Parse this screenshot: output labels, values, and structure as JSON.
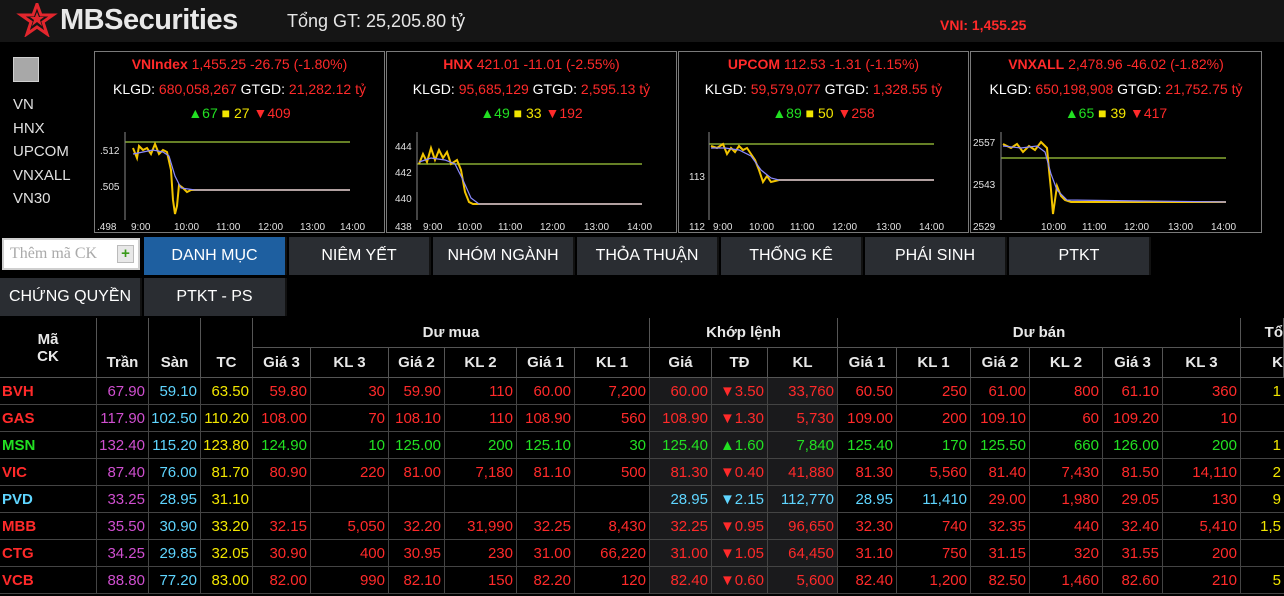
{
  "header": {
    "logo_text": "MBSecurities",
    "total_value": "Tổng GT: 25,205.80 tỷ",
    "ticker_text": "VNI: 1,455.25"
  },
  "colors": {
    "up": "#22e022",
    "down": "#ff2a2a",
    "ref": "#f2e600",
    "ceiling": "#d04fd0",
    "floor": "#5fd5ff",
    "active_tab": "#1e5fa0"
  },
  "index_list": [
    "VN",
    "HNX",
    "UPCOM",
    "VNXALL",
    "VN30"
  ],
  "panels": [
    {
      "name": "VNIndex",
      "value": "1,455.25 -26.75 (-1.80%)",
      "klgd_label": "KLGD:",
      "klgd": "680,058,267",
      "gtgd_label": "GTGD:",
      "gtgd": "21,282.12 tỷ",
      "up": "67",
      "flat": "27",
      "down": "409",
      "y_ticks": [
        ".512",
        ".505",
        ".498"
      ],
      "x_ticks": [
        "9:00",
        "10:00",
        "11:00",
        "12:00",
        "13:00",
        "14:00"
      ]
    },
    {
      "name": "HNX",
      "value": "421.01 -11.01 (-2.55%)",
      "klgd_label": "KLGD:",
      "klgd": "95,685,129",
      "gtgd_label": "GTGD:",
      "gtgd": "2,595.13 tỷ",
      "up": "49",
      "flat": "33",
      "down": "192",
      "y_ticks": [
        "444",
        "442",
        "440",
        "438"
      ],
      "x_ticks": [
        "9:00",
        "10:00",
        "11:00",
        "12:00",
        "13:00",
        "14:00"
      ]
    },
    {
      "name": "UPCOM",
      "value": "112.53 -1.31 (-1.15%)",
      "klgd_label": "KLGD:",
      "klgd": "59,579,077",
      "gtgd_label": "GTGD:",
      "gtgd": "1,328.55 tỷ",
      "up": "89",
      "flat": "50",
      "down": "258",
      "y_ticks": [
        "113",
        "112"
      ],
      "x_ticks": [
        "9:00",
        "10:00",
        "11:00",
        "12:00",
        "13:00",
        "14:00"
      ]
    },
    {
      "name": "VNXALL",
      "value": "2,478.96 -46.02 (-1.82%)",
      "klgd_label": "KLGD:",
      "klgd": "650,198,908",
      "gtgd_label": "GTGD:",
      "gtgd": "21,752.75 tỷ",
      "up": "65",
      "flat": "39",
      "down": "417",
      "y_ticks": [
        "2557",
        "2543",
        "2529"
      ],
      "x_ticks": [
        "10:00",
        "11:00",
        "12:00",
        "13:00",
        "14:00"
      ]
    }
  ],
  "search": {
    "placeholder": "Thêm mã CK",
    "add_icon": "+"
  },
  "tabs_row1": [
    "DANH MỤC",
    "NIÊM YẾT",
    "NHÓM NGÀNH",
    "THỎA THUẬN",
    "THỐNG KÊ",
    "PHÁI SINH",
    "PTKT"
  ],
  "tabs_row2": [
    "CHỨNG QUYỀN",
    "PTKT - PS"
  ],
  "active_tab": "DANH MỤC",
  "table": {
    "group_headers": {
      "code": "Mã CK",
      "buy": "Dư mua",
      "match": "Khớp lệnh",
      "sell": "Dư bán",
      "total_partial": "Tổ"
    },
    "code_line1": "Mã",
    "code_line2": "CK",
    "columns": [
      "Trần",
      "Sàn",
      "TC",
      "Giá 3",
      "KL 3",
      "Giá 2",
      "KL 2",
      "Giá 1",
      "KL 1",
      "Giá",
      "TĐ",
      "KL",
      "Giá 1",
      "KL 1",
      "Giá 2",
      "KL 2",
      "Giá 3",
      "KL 3"
    ],
    "last_col_partial": "K",
    "rows": [
      {
        "code": "BVH",
        "c": "down",
        "tran": "67.90",
        "san": "59.10",
        "tc": "63.50",
        "b3": [
          "59.80",
          "30",
          "down"
        ],
        "b2": [
          "59.90",
          "110",
          "down"
        ],
        "b1": [
          "60.00",
          "7,200",
          "down"
        ],
        "m": [
          "60.00",
          "▼3.50",
          "33,760",
          "down"
        ],
        "s1": [
          "60.50",
          "250",
          "down"
        ],
        "s2": [
          "61.00",
          "800",
          "down"
        ],
        "s3": [
          "61.10",
          "360",
          "down"
        ],
        "tot": "1"
      },
      {
        "code": "GAS",
        "c": "down",
        "tran": "117.90",
        "san": "102.50",
        "tc": "110.20",
        "b3": [
          "108.00",
          "70",
          "down"
        ],
        "b2": [
          "108.10",
          "110",
          "down"
        ],
        "b1": [
          "108.90",
          "560",
          "down"
        ],
        "m": [
          "108.90",
          "▼1.30",
          "5,730",
          "down"
        ],
        "s1": [
          "109.00",
          "200",
          "down"
        ],
        "s2": [
          "109.10",
          "60",
          "down"
        ],
        "s3": [
          "109.20",
          "10",
          "down"
        ],
        "tot": ""
      },
      {
        "code": "MSN",
        "c": "up",
        "tran": "132.40",
        "san": "115.20",
        "tc": "123.80",
        "b3": [
          "124.90",
          "10",
          "up"
        ],
        "b2": [
          "125.00",
          "200",
          "up"
        ],
        "b1": [
          "125.10",
          "30",
          "up"
        ],
        "m": [
          "125.40",
          "▲1.60",
          "7,840",
          "up"
        ],
        "s1": [
          "125.40",
          "170",
          "up"
        ],
        "s2": [
          "125.50",
          "660",
          "up"
        ],
        "s3": [
          "126.00",
          "200",
          "up"
        ],
        "tot": "1"
      },
      {
        "code": "VIC",
        "c": "down",
        "tran": "87.40",
        "san": "76.00",
        "tc": "81.70",
        "b3": [
          "80.90",
          "220",
          "down"
        ],
        "b2": [
          "81.00",
          "7,180",
          "down"
        ],
        "b1": [
          "81.10",
          "500",
          "down"
        ],
        "m": [
          "81.30",
          "▼0.40",
          "41,880",
          "down"
        ],
        "s1": [
          "81.30",
          "5,560",
          "down"
        ],
        "s2": [
          "81.40",
          "7,430",
          "down"
        ],
        "s3": [
          "81.50",
          "14,110",
          "down"
        ],
        "tot": "2"
      },
      {
        "code": "PVD",
        "c": "floor",
        "tran": "33.25",
        "san": "28.95",
        "tc": "31.10",
        "b3": [
          "",
          "",
          "down"
        ],
        "b2": [
          "",
          "",
          "down"
        ],
        "b1": [
          "",
          "",
          "down"
        ],
        "m": [
          "28.95",
          "▼2.15",
          "112,770",
          "floor"
        ],
        "s1": [
          "28.95",
          "11,410",
          "floor"
        ],
        "s2": [
          "29.00",
          "1,980",
          "down"
        ],
        "s3": [
          "29.05",
          "130",
          "down"
        ],
        "tot": "9"
      },
      {
        "code": "MBB",
        "c": "down",
        "tran": "35.50",
        "san": "30.90",
        "tc": "33.20",
        "b3": [
          "32.15",
          "5,050",
          "down"
        ],
        "b2": [
          "32.20",
          "31,990",
          "down"
        ],
        "b1": [
          "32.25",
          "8,430",
          "down"
        ],
        "m": [
          "32.25",
          "▼0.95",
          "96,650",
          "down"
        ],
        "s1": [
          "32.30",
          "740",
          "down"
        ],
        "s2": [
          "32.35",
          "440",
          "down"
        ],
        "s3": [
          "32.40",
          "5,410",
          "down"
        ],
        "tot": "1,5"
      },
      {
        "code": "CTG",
        "c": "down",
        "tran": "34.25",
        "san": "29.85",
        "tc": "32.05",
        "b3": [
          "30.90",
          "400",
          "down"
        ],
        "b2": [
          "30.95",
          "230",
          "down"
        ],
        "b1": [
          "31.00",
          "66,220",
          "down"
        ],
        "m": [
          "31.00",
          "▼1.05",
          "64,450",
          "down"
        ],
        "s1": [
          "31.10",
          "750",
          "down"
        ],
        "s2": [
          "31.15",
          "320",
          "down"
        ],
        "s3": [
          "31.55",
          "200",
          "down"
        ],
        "tot": ""
      },
      {
        "code": "VCB",
        "c": "down",
        "tran": "88.80",
        "san": "77.20",
        "tc": "83.00",
        "b3": [
          "82.00",
          "990",
          "down"
        ],
        "b2": [
          "82.10",
          "150",
          "down"
        ],
        "b1": [
          "82.20",
          "120",
          "down"
        ],
        "m": [
          "82.40",
          "▼0.60",
          "5,600",
          "down"
        ],
        "s1": [
          "82.40",
          "1,200",
          "down"
        ],
        "s2": [
          "82.50",
          "1,460",
          "down"
        ],
        "s3": [
          "82.60",
          "210",
          "down"
        ],
        "tot": "5"
      }
    ]
  }
}
